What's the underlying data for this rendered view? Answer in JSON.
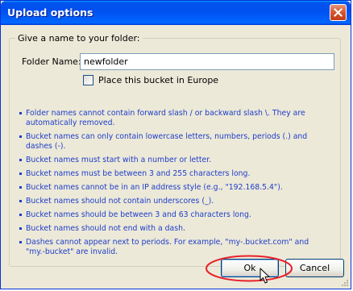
{
  "window": {
    "title": "Upload options"
  },
  "group": {
    "legend": "Give a name to your folder:",
    "folder_label": "Folder Name:",
    "folder_value": "newfolder",
    "europe_checkbox_label": "Place this bucket in Europe",
    "europe_checked": false
  },
  "rules": [
    "Folder names cannot contain forward slash / or backward slash \\. They are automatically removed.",
    "Bucket names can only contain lowercase letters, numbers, periods (.) and dashes (-).",
    "Bucket names must start with a number or letter.",
    "Bucket names must be between 3 and 255 characters long.",
    "Bucket names cannot be in an IP address style (e.g., \"192.168.5.4\").",
    "Bucket names should not contain underscores (_).",
    "Bucket names should be between 3 and 63 characters long.",
    "Bucket names should not end with a dash.",
    "Dashes cannot appear next to periods. For example, \"my-.bucket.com\" and \"my.-bucket\" are invalid."
  ],
  "buttons": {
    "ok": "Ok",
    "cancel": "Cancel"
  },
  "icons": {
    "close": "close-icon",
    "cursor": "mouse-pointer-icon",
    "grip": "resize-grip-icon"
  },
  "colors": {
    "titlebar": "#0054e3",
    "rule_text": "#1f3dc9",
    "highlight": "#e8202a",
    "dialog_bg": "#ece9d8"
  }
}
